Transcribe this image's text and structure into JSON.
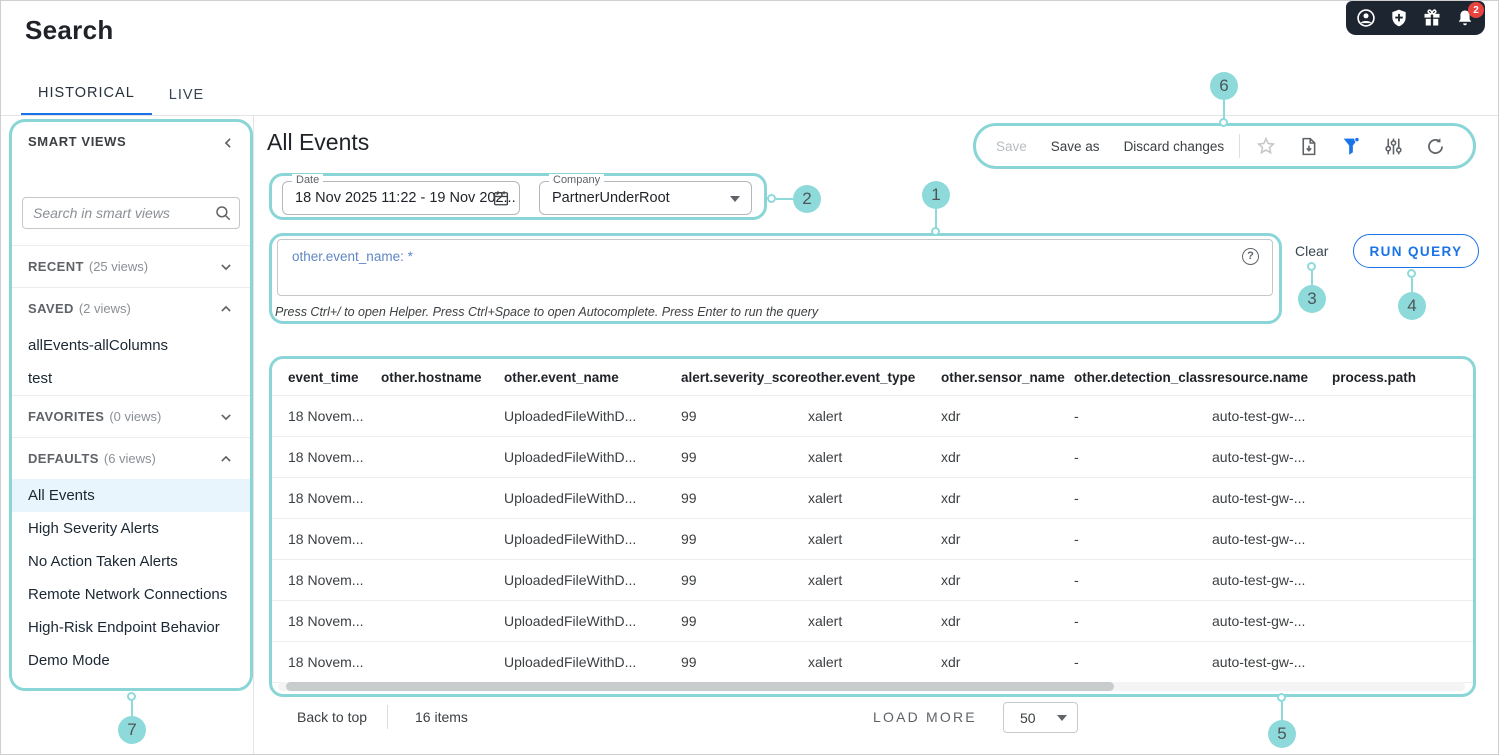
{
  "page": {
    "title": "Search"
  },
  "topbar": {
    "notification_count": "2",
    "icons": [
      "user-icon",
      "security-shield-icon",
      "gifts-icon",
      "notifications-bell-icon"
    ]
  },
  "tabs": [
    {
      "label": "HISTORICAL",
      "active": true
    },
    {
      "label": "LIVE",
      "active": false
    }
  ],
  "sidebar": {
    "title": "SMART VIEWS",
    "search_placeholder": "Search in smart views",
    "sections": [
      {
        "name": "RECENT",
        "count": "(25 views)",
        "expanded": false,
        "items": []
      },
      {
        "name": "SAVED",
        "count": "(2 views)",
        "expanded": true,
        "items": [
          "allEvents-allColumns",
          "test"
        ]
      },
      {
        "name": "FAVORITES",
        "count": "(0 views)",
        "expanded": false,
        "items": []
      },
      {
        "name": "DEFAULTS",
        "count": "(6 views)",
        "expanded": true,
        "items": [
          "All Events",
          "High Severity Alerts",
          "No Action Taken Alerts",
          "Remote Network Connections",
          "High-Risk Endpoint Behavior",
          "Demo Mode"
        ],
        "selected": "All Events"
      }
    ]
  },
  "main": {
    "title": "All Events",
    "toolbar": {
      "save": "Save",
      "save_as": "Save as",
      "discard": "Discard changes",
      "icons": [
        "favorite-star-icon",
        "export-report-icon",
        "filter-icon",
        "column-settings-icon",
        "refresh-icon"
      ]
    },
    "filters": {
      "date_label": "Date",
      "date_value": "18 Nov 2025 11:22 - 19 Nov 202...",
      "company_label": "Company",
      "company_value": "PartnerUnderRoot"
    },
    "query": {
      "text": "other.event_name: *",
      "help_glyph": "?",
      "hint": "Press Ctrl+/ to open Helper. Press Ctrl+Space to open Autocomplete. Press Enter to run the query",
      "clear_label": "Clear",
      "run_label": "RUN QUERY"
    },
    "table": {
      "columns": [
        "event_time",
        "other.hostname",
        "other.event_name",
        "alert.severity_score",
        "other.event_type",
        "other.sensor_name",
        "other.detection_class",
        "resource.name",
        "process.path"
      ],
      "rows": [
        [
          "18 Novem...",
          "",
          "UploadedFileWithD...",
          "99",
          "xalert",
          "xdr",
          "-",
          "auto-test-gw-...",
          ""
        ],
        [
          "18 Novem...",
          "",
          "UploadedFileWithD...",
          "99",
          "xalert",
          "xdr",
          "-",
          "auto-test-gw-...",
          ""
        ],
        [
          "18 Novem...",
          "",
          "UploadedFileWithD...",
          "99",
          "xalert",
          "xdr",
          "-",
          "auto-test-gw-...",
          ""
        ],
        [
          "18 Novem...",
          "",
          "UploadedFileWithD...",
          "99",
          "xalert",
          "xdr",
          "-",
          "auto-test-gw-...",
          ""
        ],
        [
          "18 Novem...",
          "",
          "UploadedFileWithD...",
          "99",
          "xalert",
          "xdr",
          "-",
          "auto-test-gw-...",
          ""
        ],
        [
          "18 Novem...",
          "",
          "UploadedFileWithD...",
          "99",
          "xalert",
          "xdr",
          "-",
          "auto-test-gw-...",
          ""
        ],
        [
          "18 Novem...",
          "",
          "UploadedFileWithD...",
          "99",
          "xalert",
          "xdr",
          "-",
          "auto-test-gw-...",
          ""
        ]
      ]
    },
    "footer": {
      "back_to_top": "Back to top",
      "items_count": "16 items",
      "load_more": "LOAD MORE",
      "page_size": "50"
    }
  },
  "callouts": [
    "1",
    "2",
    "3",
    "4",
    "5",
    "6",
    "7"
  ],
  "colors": {
    "accent_teal": "#8AD6D7",
    "accent_blue": "#1A73E8",
    "badge_red": "#E8433F",
    "topbar_dark": "#1D2531",
    "selected_item_bg": "#E9F5FC"
  }
}
